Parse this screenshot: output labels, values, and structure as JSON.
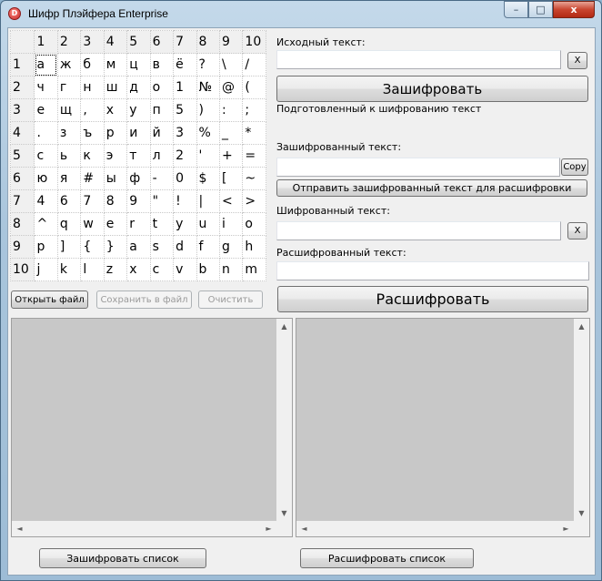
{
  "window": {
    "title": "Шифр Плэйфера Enterprise",
    "icon": "app-icon",
    "controls": {
      "minimize": "–",
      "maximize": "□",
      "close": "x"
    }
  },
  "grid": {
    "col_headers": [
      "1",
      "2",
      "3",
      "4",
      "5",
      "6",
      "7",
      "8",
      "9",
      "10"
    ],
    "rows": [
      {
        "h": "1",
        "c": [
          "а",
          "ж",
          "б",
          "м",
          "ц",
          "в",
          "ё",
          "?",
          "\\",
          "/"
        ]
      },
      {
        "h": "2",
        "c": [
          "ч",
          "г",
          "н",
          "ш",
          "д",
          "о",
          "1",
          "№",
          "@",
          "("
        ]
      },
      {
        "h": "3",
        "c": [
          "е",
          "щ",
          ",",
          "х",
          "у",
          "п",
          "5",
          ")",
          ":",
          ";"
        ]
      },
      {
        "h": "4",
        "c": [
          ".",
          "з",
          "ъ",
          "р",
          "и",
          "й",
          "3",
          "%",
          "_",
          "*"
        ]
      },
      {
        "h": "5",
        "c": [
          "с",
          "ь",
          "к",
          "э",
          "т",
          "л",
          "2",
          "'",
          "+",
          "="
        ]
      },
      {
        "h": "6",
        "c": [
          "ю",
          "я",
          "#",
          "ы",
          "ф",
          "-",
          "0",
          "$",
          "[",
          "~"
        ]
      },
      {
        "h": "7",
        "c": [
          "4",
          "6",
          "7",
          "8",
          "9",
          "\"",
          "!",
          "|",
          "<",
          ">"
        ]
      },
      {
        "h": "8",
        "c": [
          "^",
          "q",
          "w",
          "e",
          "r",
          "t",
          "y",
          "u",
          "i",
          "o"
        ]
      },
      {
        "h": "9",
        "c": [
          "p",
          "]",
          "{",
          "}",
          "a",
          "s",
          "d",
          "f",
          "g",
          "h"
        ]
      },
      {
        "h": "10",
        "c": [
          "j",
          "k",
          "l",
          "z",
          "x",
          "c",
          "v",
          "b",
          "n",
          "m"
        ]
      }
    ]
  },
  "source": {
    "label": "Исходный текст:",
    "value": "",
    "clear_label": "X"
  },
  "encrypt_button": "Зашифровать",
  "prepared_label": "Подготовленный к шифрованию текст",
  "encrypted": {
    "label": "Зашифрованный текст:",
    "value": "",
    "copy_label": "Copy"
  },
  "send_button": "Отправить зашифрованный текст для расшифровки",
  "cipher": {
    "label": "Шифрованный текст:",
    "value": "",
    "clear_label": "X"
  },
  "decrypted": {
    "label": "Расшифрованный текст:",
    "value": ""
  },
  "file_buttons": {
    "open": "Открыть файл",
    "save": "Сохранить в файл",
    "clear": "Очистить"
  },
  "decrypt_button": "Расшифровать",
  "list_buttons": {
    "encrypt_list": "Зашифровать список",
    "decrypt_list": "Расшифровать список"
  }
}
